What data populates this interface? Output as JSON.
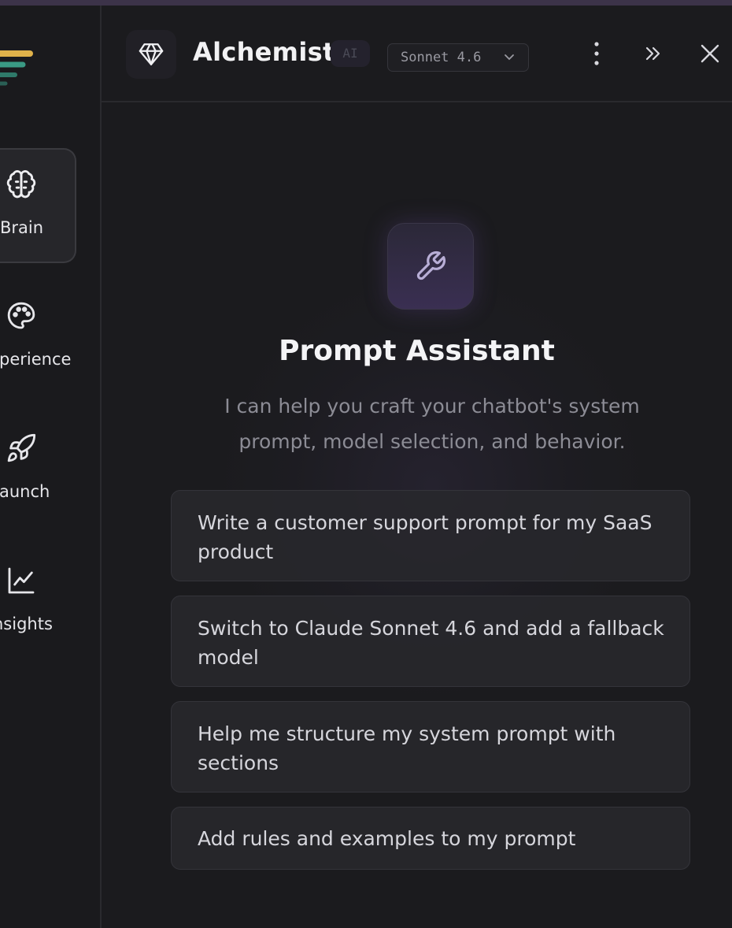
{
  "sidebar": {
    "items": [
      {
        "label": "Brain",
        "icon": "brain-icon",
        "active": true
      },
      {
        "label": "perience",
        "icon": "palette-icon",
        "active": false
      },
      {
        "label": "aunch",
        "icon": "rocket-icon",
        "active": false
      },
      {
        "label": "nsights",
        "icon": "chart-line-icon",
        "active": false
      }
    ],
    "logo_colors": [
      "#e0b24a",
      "#3a9a84",
      "#2f7a6a",
      "#2a5f55"
    ]
  },
  "header": {
    "title": "Alchemist",
    "badge": "AI",
    "model_select": {
      "value": "Sonnet 4.6"
    },
    "icons": [
      "gem-icon",
      "more-vertical-icon",
      "chevrons-right-icon",
      "close-icon"
    ]
  },
  "main": {
    "icon": "wrench-icon",
    "title": "Prompt Assistant",
    "subtitle": "I can help you craft your chatbot's system prompt, model selection, and behavior.",
    "suggestions": [
      "Write a customer support prompt for my SaaS product",
      "Switch to Claude Sonnet 4.6 and add a fallback model",
      "Help me structure my system prompt with sections",
      "Add rules and examples to my prompt"
    ]
  },
  "colors": {
    "accent_purple": "#3a2f52",
    "background": "#1b1b1e",
    "top_strip": "#3c3349"
  }
}
